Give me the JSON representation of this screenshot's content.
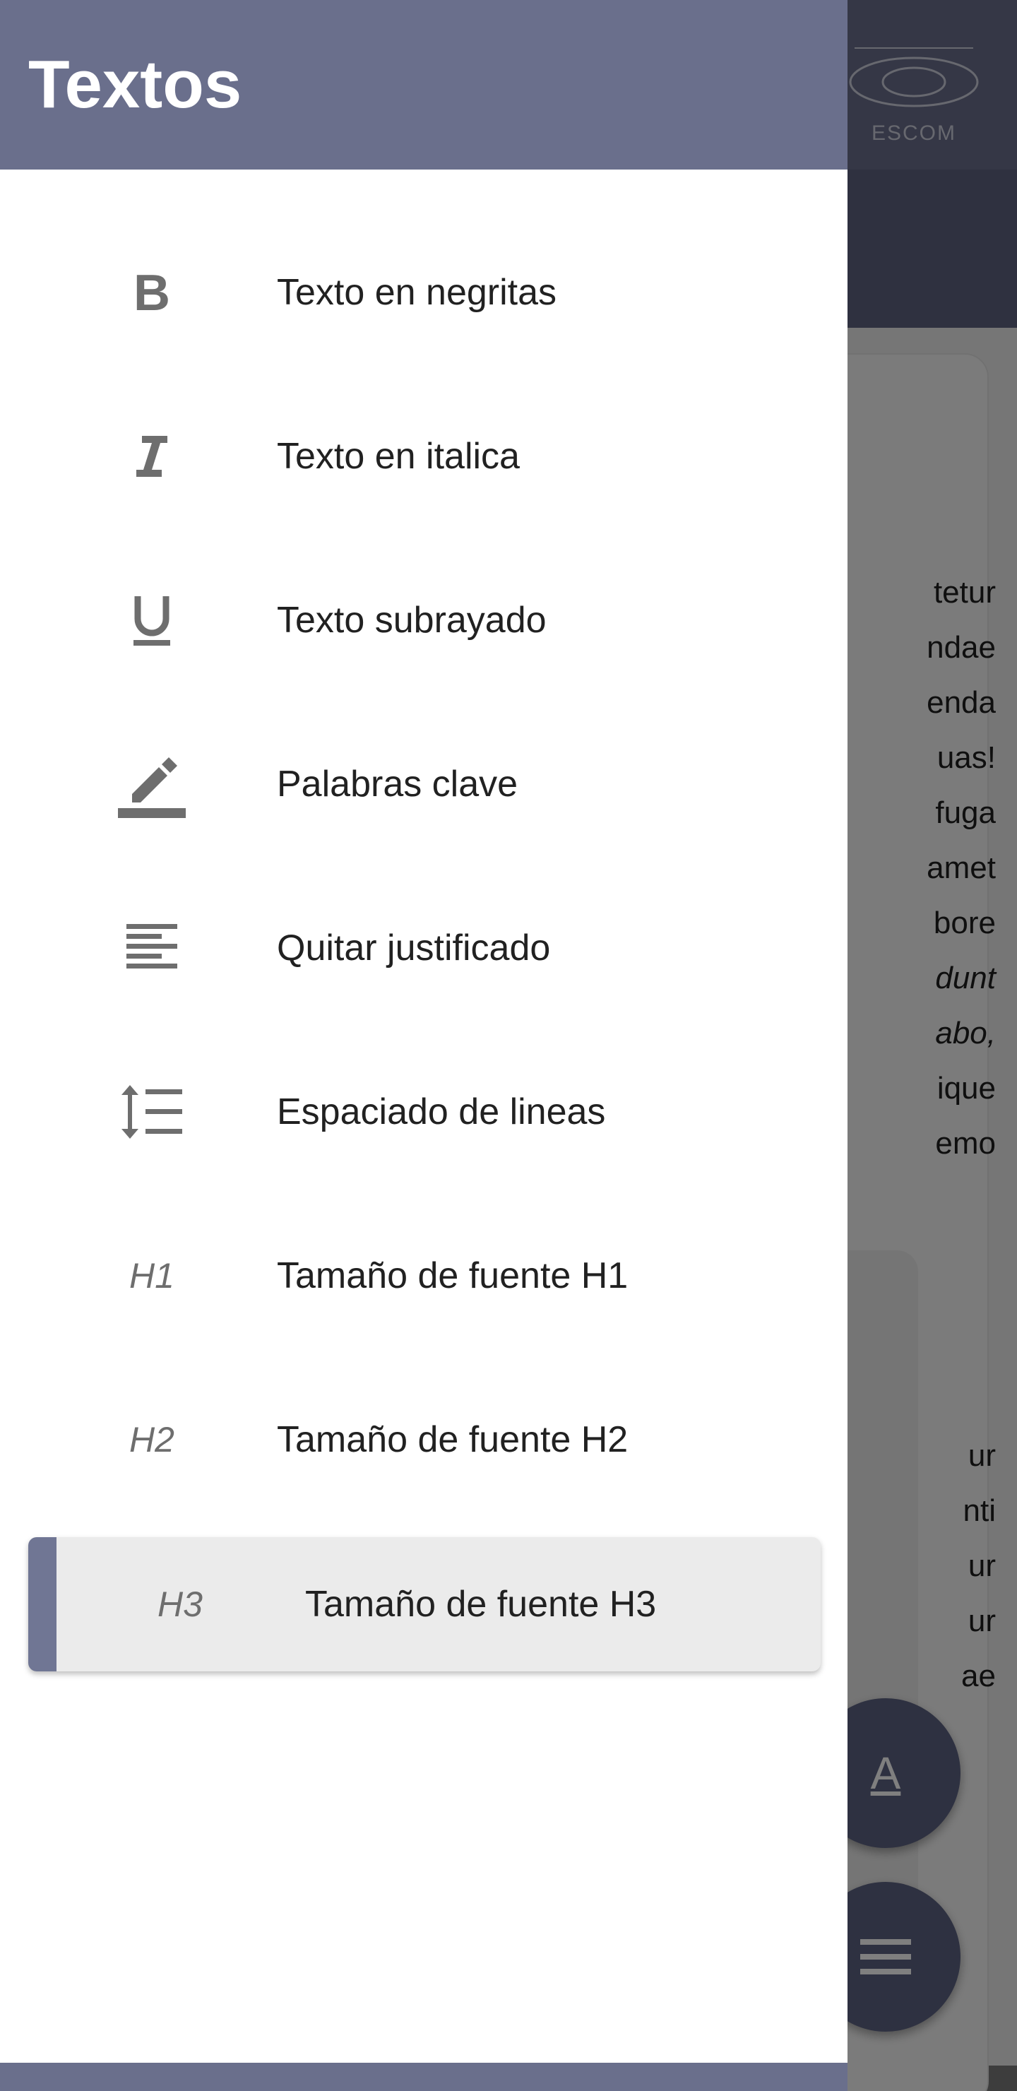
{
  "drawer": {
    "title": "Textos",
    "items": [
      {
        "icon": "bold-icon",
        "label": "Texto en negritas",
        "active": false
      },
      {
        "icon": "italic-icon",
        "label": "Texto en italica",
        "active": false
      },
      {
        "icon": "underline-icon",
        "label": "Texto subrayado",
        "active": false
      },
      {
        "icon": "edit-pencil-icon",
        "label": "Palabras clave",
        "active": false
      },
      {
        "icon": "align-left-icon",
        "label": "Quitar justificado",
        "active": false
      },
      {
        "icon": "line-spacing-icon",
        "label": "Espaciado de lineas",
        "active": false
      },
      {
        "icon": "h1-icon",
        "icon_text": "H1",
        "label": "Tamaño de fuente H1",
        "active": false
      },
      {
        "icon": "h2-icon",
        "icon_text": "H2",
        "label": "Tamaño de fuente H2",
        "active": false
      },
      {
        "icon": "h3-icon",
        "icon_text": "H3",
        "label": "Tamaño de fuente H3",
        "active": true
      }
    ]
  },
  "background": {
    "logo_text": "ESCOM",
    "text_fragments": [
      "tetur",
      "ndae",
      "enda",
      "uas!",
      "fuga",
      "amet",
      "bore",
      "dunt",
      "abo,",
      "ique",
      "emo"
    ],
    "text_fragments_2": [
      "ur",
      "nti",
      "ur",
      "ur",
      "ae"
    ],
    "fab_text_label": "A"
  },
  "colors": {
    "header": "#6a6f8c",
    "accent": "#707694",
    "active_bg": "#ebebeb",
    "icon": "#6e6e6e",
    "label": "#212121"
  }
}
